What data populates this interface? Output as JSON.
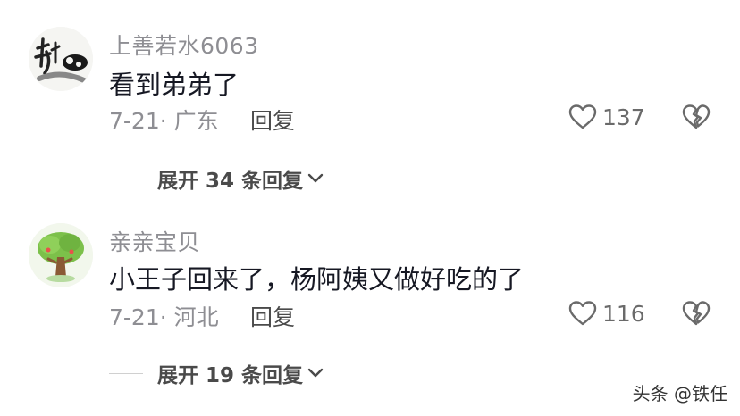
{
  "comments": [
    {
      "avatar_icon": "ink-calligraphy-avatar",
      "username": "上善若水6063",
      "content": "看到弟弟了",
      "meta": "7-21· 广东",
      "reply_label": "回复",
      "like_count": "137",
      "expand_label": "展开 34 条回复"
    },
    {
      "avatar_icon": "tree-avatar",
      "username": "亲亲宝贝",
      "content": "小王子回来了，杨阿姨又做好吃的了",
      "meta": "7-21· 河北",
      "reply_label": "回复",
      "like_count": "116",
      "expand_label": "展开 19 条回复"
    }
  ],
  "watermark": "头条 @铁任",
  "colors": {
    "text_primary": "#161823",
    "text_secondary": "#8e8e93",
    "icon_stroke": "#6a6a6a"
  }
}
